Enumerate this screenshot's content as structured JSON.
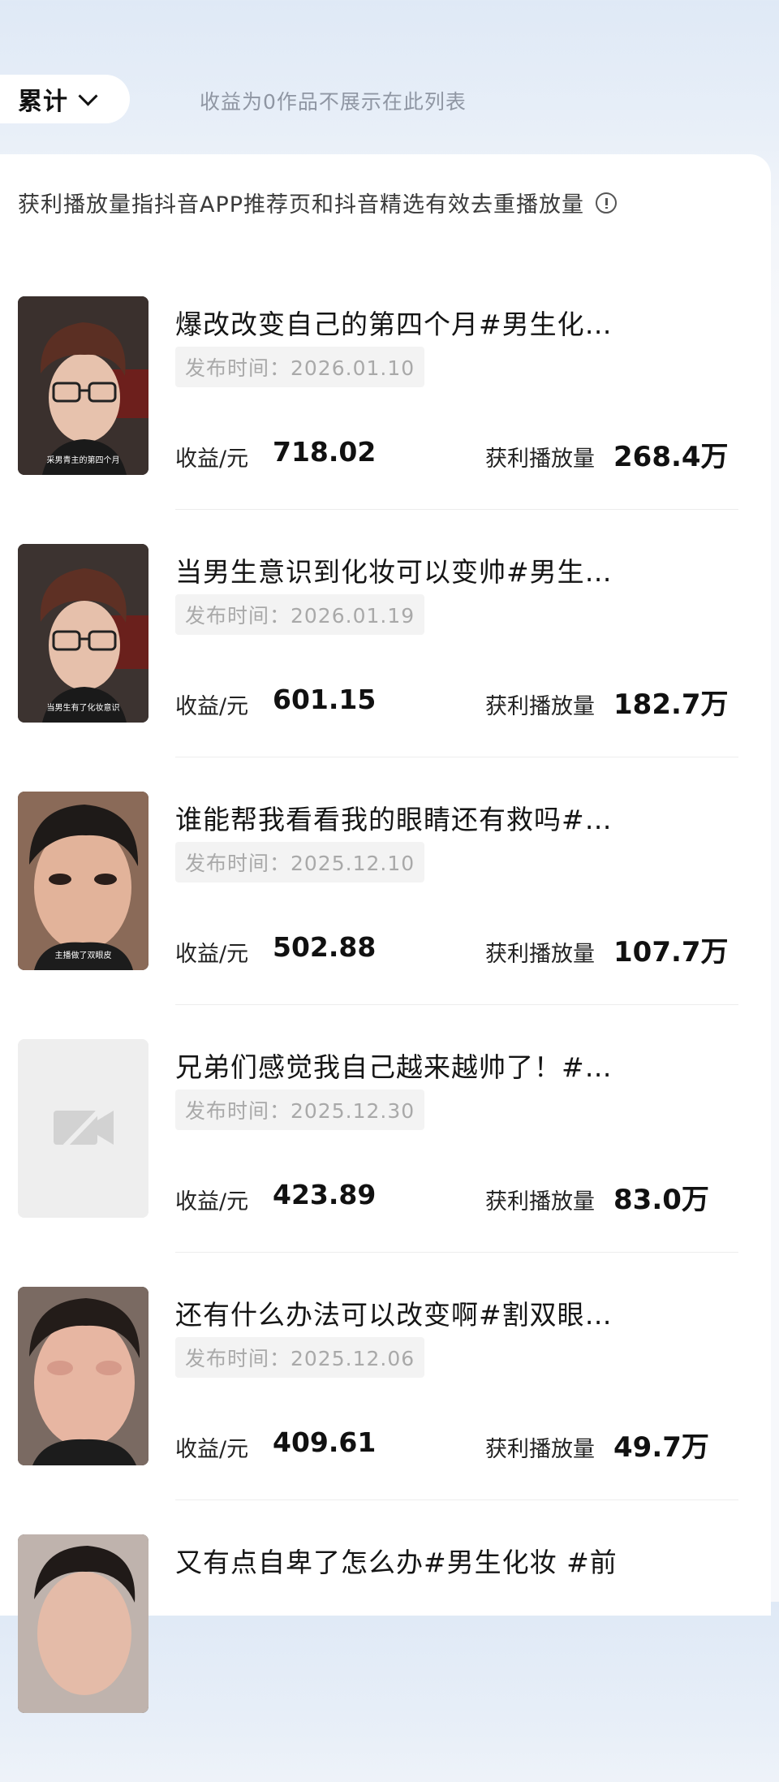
{
  "header": {
    "period_label": "累计",
    "zero_revenue_note": "收益为0作品不展示在此列表"
  },
  "card": {
    "note": "获利播放量指抖音APP推荐页和抖音精选有效去重播放量"
  },
  "labels": {
    "revenue": "收益/元",
    "plays": "获利播放量"
  },
  "videos": [
    {
      "title": "爆改改变自己的第四个月#男生化…",
      "date": "发布时间：2026.01.10",
      "revenue": "718.02",
      "plays": "268.4万",
      "thumb_caption": "采男青主的第四个月"
    },
    {
      "title": "当男生意识到化妆可以变帅#男生…",
      "date": "发布时间：2026.01.19",
      "revenue": "601.15",
      "plays": "182.7万",
      "thumb_caption": "当男生有了化妆意识"
    },
    {
      "title": "谁能帮我看看我的眼睛还有救吗#…",
      "date": "发布时间：2025.12.10",
      "revenue": "502.88",
      "plays": "107.7万",
      "thumb_caption": "主播做了双眼皮"
    },
    {
      "title": "兄弟们感觉我自己越来越帅了！#…",
      "date": "发布时间：2025.12.30",
      "revenue": "423.89",
      "plays": "83.0万",
      "thumb_caption": ""
    },
    {
      "title": "还有什么办法可以改变啊#割双眼…",
      "date": "发布时间：2025.12.06",
      "revenue": "409.61",
      "plays": "49.7万",
      "thumb_caption": ""
    },
    {
      "title": "又有点自卑了怎么办#男生化妆 #前",
      "date": "",
      "revenue": "",
      "plays": "",
      "thumb_caption": ""
    }
  ]
}
